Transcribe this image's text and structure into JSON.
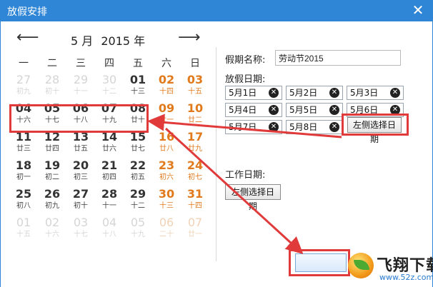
{
  "window": {
    "title": "放假安排",
    "close_glyph": "✕"
  },
  "calendar": {
    "prev_glyph": "⟵",
    "next_glyph": "⟶",
    "month": "5 月",
    "year": "2015 年",
    "weekdays": [
      "一",
      "二",
      "三",
      "四",
      "五",
      "六",
      "日"
    ],
    "rows": [
      [
        {
          "d": "27",
          "l": "初九",
          "f": true
        },
        {
          "d": "28",
          "l": "初十",
          "f": true
        },
        {
          "d": "29",
          "l": "十一",
          "f": true
        },
        {
          "d": "30",
          "l": "十二",
          "f": true
        },
        {
          "d": "01",
          "l": "十三"
        },
        {
          "d": "02",
          "l": "十四"
        },
        {
          "d": "03",
          "l": "十五"
        }
      ],
      [
        {
          "d": "04",
          "l": "十六"
        },
        {
          "d": "05",
          "l": "十七"
        },
        {
          "d": "06",
          "l": "十八"
        },
        {
          "d": "07",
          "l": "十九"
        },
        {
          "d": "08",
          "l": "廿十"
        },
        {
          "d": "09",
          "l": "廿一"
        },
        {
          "d": "10",
          "l": "廿二"
        }
      ],
      [
        {
          "d": "11",
          "l": "廿三"
        },
        {
          "d": "12",
          "l": "廿四"
        },
        {
          "d": "13",
          "l": "廿五"
        },
        {
          "d": "14",
          "l": "廿六"
        },
        {
          "d": "15",
          "l": "廿七"
        },
        {
          "d": "16",
          "l": "廿八"
        },
        {
          "d": "17",
          "l": "廿九"
        }
      ],
      [
        {
          "d": "18",
          "l": "初一"
        },
        {
          "d": "19",
          "l": "初二"
        },
        {
          "d": "20",
          "l": "初三"
        },
        {
          "d": "21",
          "l": "初四"
        },
        {
          "d": "22",
          "l": "初五"
        },
        {
          "d": "23",
          "l": "初六"
        },
        {
          "d": "24",
          "l": "初七"
        }
      ],
      [
        {
          "d": "25",
          "l": "初八"
        },
        {
          "d": "26",
          "l": "初九"
        },
        {
          "d": "27",
          "l": "初十"
        },
        {
          "d": "28",
          "l": "十一"
        },
        {
          "d": "29",
          "l": "十二"
        },
        {
          "d": "30",
          "l": "十三"
        },
        {
          "d": "31",
          "l": "十四"
        }
      ],
      [
        {
          "d": "01",
          "l": "十五",
          "f": true
        },
        {
          "d": "02",
          "l": "十六",
          "f": true
        },
        {
          "d": "03",
          "l": "十七",
          "f": true
        },
        {
          "d": "04",
          "l": "十八",
          "f": true
        },
        {
          "d": "05",
          "l": "十九",
          "f": true
        },
        {
          "d": "06",
          "l": "二十",
          "f": true
        },
        {
          "d": "07",
          "l": "廿一",
          "f": true
        }
      ]
    ]
  },
  "holiday": {
    "name_label": "假期名称:",
    "name_value": "劳动节2015",
    "dates_label": "放假日期:",
    "dates": [
      "5月1日",
      "5月2日",
      "5月3日",
      "5月4日",
      "5月5日",
      "5月6日",
      "5月7日",
      "5月8日"
    ],
    "remove_glyph": "✕",
    "pick_left_label": "左侧选择日期"
  },
  "work": {
    "dates_label": "工作日期:",
    "pick_left_label": "左侧选择日期"
  },
  "watermark": {
    "brand": "飞翔下载",
    "url": "www.52z.com"
  },
  "colors": {
    "titlebar": "#2f86d6",
    "weekend": "#e07a1c",
    "annotation": "#e03a3a"
  }
}
